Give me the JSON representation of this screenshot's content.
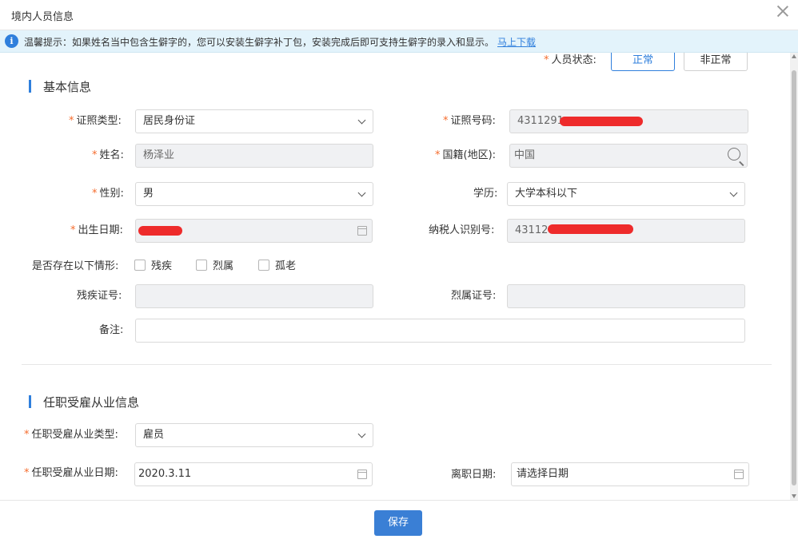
{
  "dialog": {
    "title": "境内人员信息"
  },
  "tip": {
    "text": "温馨提示：如果姓名当中包含生僻字的，您可以安装生僻字补丁包，安装完成后即可支持生僻字的录入和显示。",
    "link": "马上下载"
  },
  "status": {
    "label": "人员状态:",
    "options": [
      "正常",
      "非正常"
    ],
    "selected": "正常"
  },
  "basic": {
    "section_title": "基本信息",
    "id_type": {
      "label": "证照类型:",
      "value": "居民身份证"
    },
    "id_number": {
      "label": "证照号码:",
      "value": "4311291"
    },
    "name": {
      "label": "姓名:",
      "value": "杨泽业"
    },
    "nationality": {
      "label": "国籍(地区):",
      "value": "中国"
    },
    "gender": {
      "label": "性别:",
      "value": "男"
    },
    "education": {
      "label": "学历:",
      "value": "大学本科以下"
    },
    "birth_date": {
      "label": "出生日期:",
      "value": ""
    },
    "taxpayer_id": {
      "label": "纳税人识别号:",
      "value": "43112"
    },
    "situation": {
      "label": "是否存在以下情形:",
      "options": [
        "残疾",
        "烈属",
        "孤老"
      ]
    },
    "disability_no": {
      "label": "残疾证号:",
      "value": ""
    },
    "martyr_no": {
      "label": "烈属证号:",
      "value": ""
    },
    "remark": {
      "label": "备注:",
      "value": ""
    }
  },
  "employment": {
    "section_title": "任职受雇从业信息",
    "type": {
      "label": "任职受雇从业类型:",
      "value": "雇员"
    },
    "start_date": {
      "label": "任职受雇从业日期:",
      "value": "2020.3.11"
    },
    "leave_date": {
      "label": "离职日期:",
      "placeholder": "请选择日期"
    }
  },
  "footer": {
    "save_label": "保存"
  },
  "colors": {
    "primary": "#2f7fdc",
    "required": "#f56c2d",
    "redaction": "#ee2b2b",
    "tip_bg": "#e3f3fb"
  }
}
